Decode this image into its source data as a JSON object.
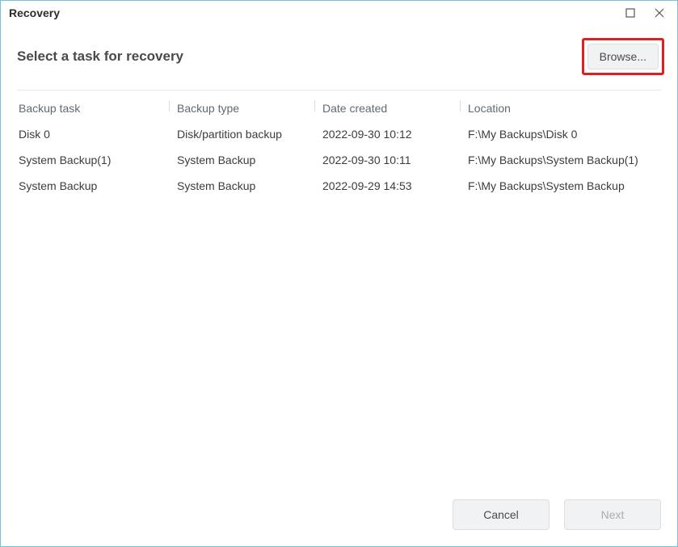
{
  "window": {
    "title": "Recovery"
  },
  "header": {
    "title": "Select a task for recovery",
    "browse_label": "Browse..."
  },
  "columns": {
    "task": "Backup task",
    "type": "Backup type",
    "date": "Date created",
    "location": "Location"
  },
  "rows": [
    {
      "task": "Disk 0",
      "type": "Disk/partition backup",
      "date": "2022-09-30 10:12",
      "location": "F:\\My Backups\\Disk 0"
    },
    {
      "task": "System Backup(1)",
      "type": "System Backup",
      "date": "2022-09-30 10:11",
      "location": "F:\\My Backups\\System Backup(1)"
    },
    {
      "task": "System Backup",
      "type": "System Backup",
      "date": "2022-09-29 14:53",
      "location": "F:\\My Backups\\System Backup"
    }
  ],
  "footer": {
    "cancel": "Cancel",
    "next": "Next"
  }
}
